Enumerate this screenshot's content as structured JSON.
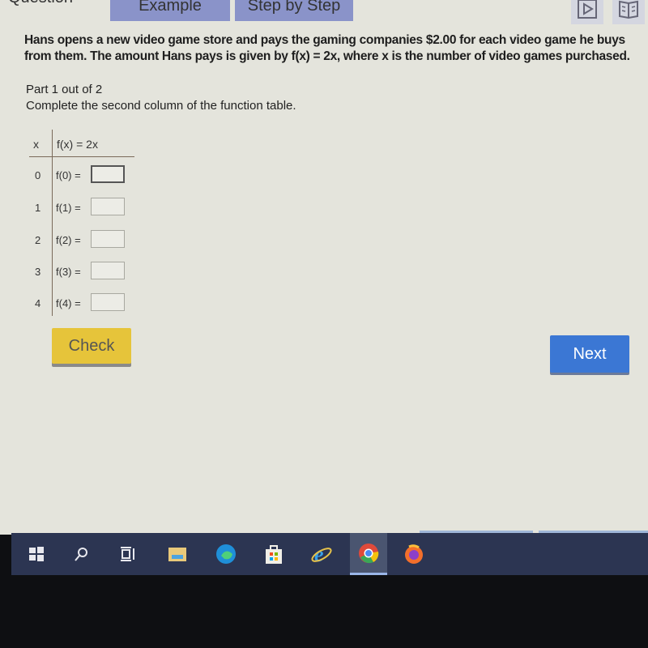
{
  "header": {
    "tabs": [
      {
        "label": "Question"
      },
      {
        "label": "Example"
      },
      {
        "label": "Step by Step"
      }
    ],
    "icons": [
      "video-icon",
      "book-icon"
    ]
  },
  "problem": {
    "line1": "Hans opens a new video game store and pays the gaming companies $2.00 for each video game he buys",
    "line2": "from them. The amount Hans pays is given by f(x) = 2x, where x is the number of video games purchased."
  },
  "part_label": "Part 1 out of 2",
  "instruction": "Complete the second column of the function table.",
  "table": {
    "headers": [
      "x",
      "f(x) = 2x"
    ],
    "rows": [
      {
        "x": "0",
        "label": "f(0) =",
        "value": ""
      },
      {
        "x": "1",
        "label": "f(1) =",
        "value": ""
      },
      {
        "x": "2",
        "label": "f(2) =",
        "value": ""
      },
      {
        "x": "3",
        "label": "f(3) =",
        "value": ""
      },
      {
        "x": "4",
        "label": "f(4) =",
        "value": ""
      }
    ]
  },
  "buttons": {
    "check": "Check",
    "next": "Next"
  },
  "colors": {
    "check": "#e6c43a",
    "next": "#3b77d4",
    "tab": "#8a93c9",
    "taskbar": "#2c3552"
  },
  "taskbar": {
    "items": [
      "windows-start",
      "search",
      "task-view",
      "file-explorer",
      "edge",
      "microsoft-store",
      "internet-explorer",
      "chrome",
      "firefox"
    ],
    "active": "chrome"
  }
}
